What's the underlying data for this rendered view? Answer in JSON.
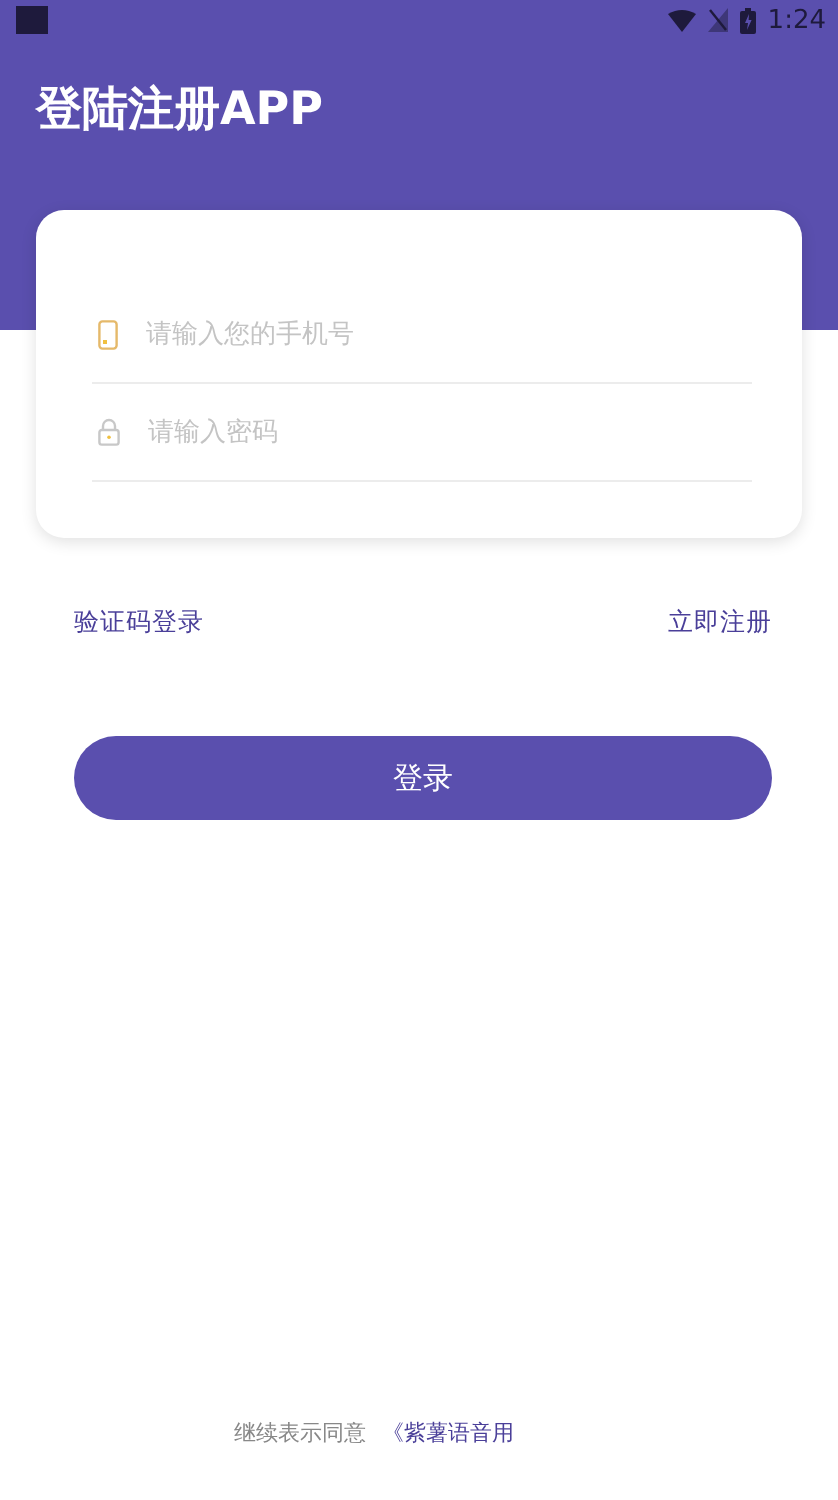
{
  "status_bar": {
    "time": "1:24"
  },
  "header": {
    "title": "登陆注册APP"
  },
  "form": {
    "fields": [
      {
        "kind": "phone",
        "placeholder": "请输入您的手机号"
      },
      {
        "kind": "password",
        "placeholder": "请输入密码"
      }
    ]
  },
  "links": {
    "left": "验证码登录",
    "right": "立即注册"
  },
  "login_button": "登录",
  "footer": {
    "text": "继续表示同意",
    "link": "《紫薯语音用"
  }
}
